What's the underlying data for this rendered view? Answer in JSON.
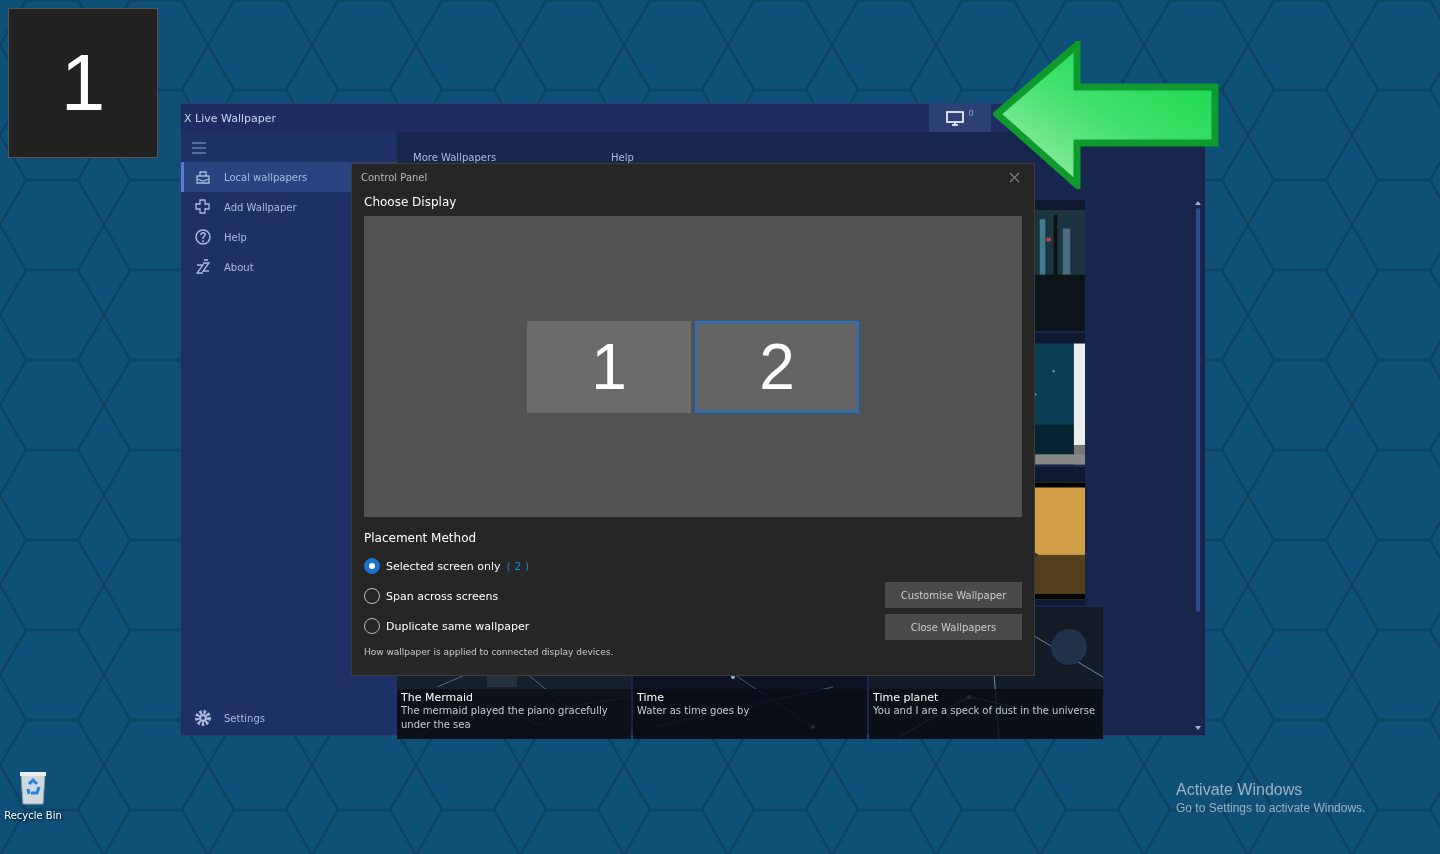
{
  "desktop": {
    "display_badge": "1",
    "icons": [
      {
        "label": "Recycle Bin"
      }
    ],
    "activation_notice": {
      "title": "Activate Windows",
      "text": "Go to Settings to activate Windows."
    }
  },
  "window": {
    "title": "X Live Wallpaper",
    "display_button": {
      "count": "0"
    }
  },
  "sidebar": {
    "items": [
      {
        "label": "Local wallpapers",
        "selected": true
      },
      {
        "label": "Add Wallpaper",
        "selected": false
      },
      {
        "label": "Help",
        "selected": false
      },
      {
        "label": "About",
        "selected": false
      }
    ],
    "footer": {
      "label": "Settings"
    }
  },
  "tabs": [
    {
      "label": "More Wallpapers"
    },
    {
      "label": "Help"
    }
  ],
  "wallpapers": [
    {
      "kind": "picture"
    },
    {
      "kind": "picture"
    },
    {
      "kind": "picture"
    },
    {
      "title": "The Mermaid",
      "description": "The mermaid played the piano gracefully under the sea"
    },
    {
      "title": "Time",
      "description": "Water as time goes by"
    },
    {
      "title": "Time planet",
      "description": "You and I are a speck of dust in the universe"
    }
  ],
  "dialog": {
    "title": "Control Panel",
    "section": "Choose Display",
    "displays": [
      {
        "label": "1",
        "selected": false
      },
      {
        "label": "2",
        "selected": true
      }
    ],
    "placement_title": "Placement Method",
    "options": [
      {
        "label": "Selected screen only",
        "note": "( 2 )",
        "selected": true
      },
      {
        "label": "Span across screens",
        "selected": false
      },
      {
        "label": "Duplicate same wallpaper",
        "selected": false
      }
    ],
    "hint": "How wallpaper is applied to connected display devices.",
    "buttons": [
      "Customise Wallpaper",
      "Close Wallpapers"
    ]
  }
}
